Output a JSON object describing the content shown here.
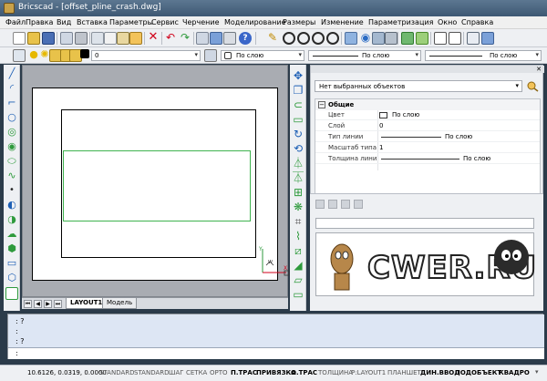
{
  "window": {
    "title": "Bricscad - [offset_pline_crash.dwg]"
  },
  "menu": [
    "Файл",
    "Правка",
    "Вид",
    "Вставка",
    "Параметры",
    "Сервис",
    "Черчение",
    "Моделирование",
    "Размеры",
    "Изменение",
    "Параметризация",
    "Окно",
    "Справка"
  ],
  "layer_bar": {
    "layer_value": "0",
    "color_value": "По слою",
    "linetype_value": "По слою",
    "lineweight_value": "По слою"
  },
  "tabs": [
    "LAYOUT1",
    "Модель"
  ],
  "properties": {
    "selection": "Нет выбранных объектов",
    "section": "Общие",
    "rows": [
      {
        "name": "Цвет",
        "value": "По слою"
      },
      {
        "name": "Слой",
        "value": "0"
      },
      {
        "name": "Тип линии",
        "value": "По слою"
      },
      {
        "name": "Масштаб типа л",
        "value": "1"
      },
      {
        "name": "Толщина линии",
        "value": "По слою"
      }
    ]
  },
  "watermark": "CWER.RU",
  "command": {
    "history": [
      ": ?",
      ":",
      ": ?"
    ],
    "prompt": ":"
  },
  "status": {
    "coords": "10.6126, 0.0319, 0.0000",
    "buttons": [
      "STANDARD",
      "STANDARD",
      "ШАГ",
      "СЕТКА",
      "ОРТО",
      "П.ТРАС",
      "ПРИВЯЗКА",
      "О.ТРАС",
      "ТОЛЩИНА",
      "P:LAYOUT1",
      "ПЛАНШЕТ",
      "ДИН.ВВОД",
      "ПОДОБЪЕКТ",
      "КВАДРО"
    ]
  },
  "colors": {
    "accent_green": "#3fb34f",
    "command_bg": "#dde6f4"
  }
}
